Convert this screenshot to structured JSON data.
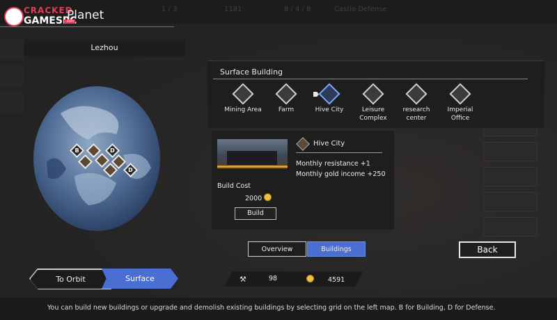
{
  "header": {
    "screen_title": "Planet",
    "logo_line1": "CRACKED",
    "logo_line2": "GAMESPC",
    "logo_tag": ".com",
    "ghost_values": [
      "1 / 3",
      "1181",
      "8 / 4 / 8"
    ],
    "ghost_label": "Castle Defense"
  },
  "region": {
    "name": "Lezhou"
  },
  "map": {
    "tiles": [
      {
        "kind": "B",
        "label": "B"
      },
      {
        "kind": "building",
        "label": ""
      },
      {
        "kind": "D",
        "label": "D"
      },
      {
        "kind": "building",
        "label": ""
      },
      {
        "kind": "building",
        "label": ""
      },
      {
        "kind": "building",
        "label": ""
      },
      {
        "kind": "building",
        "label": ""
      },
      {
        "kind": "D",
        "label": "D"
      }
    ]
  },
  "surface_building": {
    "title": "Surface Building",
    "options": [
      {
        "label": "Mining Area",
        "icon": "mining-icon",
        "selected": false
      },
      {
        "label": "Farm",
        "icon": "farm-icon",
        "selected": false
      },
      {
        "label": "Hive City",
        "icon": "hive-city-icon",
        "selected": true
      },
      {
        "label": "Leisure Complex",
        "icon": "leisure-icon",
        "selected": false
      },
      {
        "label": "research center",
        "icon": "research-icon",
        "selected": false
      },
      {
        "label": "Imperial Office",
        "icon": "imperial-icon",
        "selected": false
      }
    ]
  },
  "detail": {
    "name": "Hive City",
    "effects": [
      "Monthly resistance  +1",
      "Monthly gold income +250"
    ],
    "cost_label": "Build Cost",
    "cost_value": "2000",
    "build_label": "Build"
  },
  "tabs": {
    "overview": "Overview",
    "buildings": "Buildings",
    "active": "Buildings"
  },
  "back_label": "Back",
  "view_toggle": {
    "orbit": "To Orbit",
    "surface": "Surface",
    "active": "Surface"
  },
  "resources": {
    "production": "98",
    "gold": "4591"
  },
  "status_text": "You can build new buildings or upgrade and demolish existing buildings by selecting grid on the left map. B for Building, D for Defense.",
  "colors": {
    "accent_blue": "#4a6ed1",
    "gold": "#f0c040",
    "panel": "#1e1e1e"
  }
}
